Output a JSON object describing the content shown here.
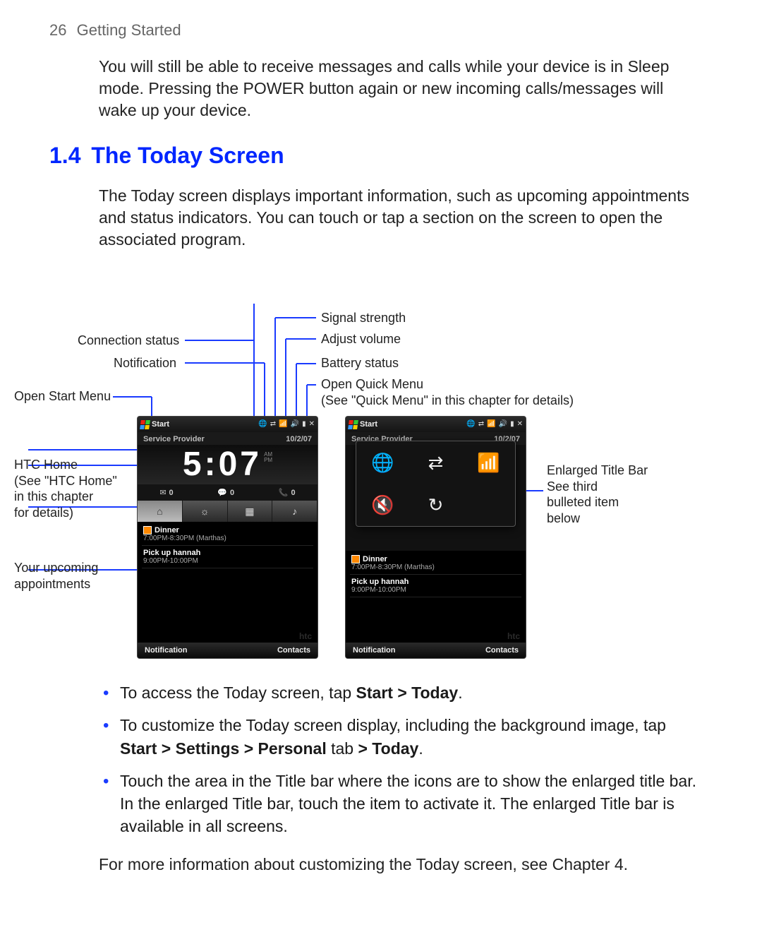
{
  "page": {
    "number": "26",
    "chapter": "Getting Started"
  },
  "intro_para": "You will still be able to receive messages and calls while your device is in Sleep mode. Pressing the POWER button again or new incoming calls/messages will wake up your device.",
  "section": {
    "number": "1.4",
    "title": "The Today Screen",
    "para": "The Today screen displays important information, such as upcoming appointments and status indicators. You can touch or tap a section on the screen to open the associated program."
  },
  "callouts": {
    "connection_status": "Connection status",
    "notification": "Notification",
    "open_start_menu": "Open Start Menu",
    "htc_home": "HTC Home\n(See \"HTC Home\"\nin this chapter\nfor details)",
    "your_upcoming": "Your upcoming\nappointments",
    "signal_strength": "Signal strength",
    "adjust_volume": "Adjust volume",
    "battery_status": "Battery status",
    "open_quick_menu": "Open Quick Menu\n(See \"Quick Menu\" in this chapter for details)",
    "enlarged_title_bar": "Enlarged Title Bar\nSee third\nbulleted item\nbelow"
  },
  "phone": {
    "start_label": "Start",
    "provider": "Service Provider",
    "date": "10/2/07",
    "clock_time": "5:07",
    "ampm_top": "AM",
    "ampm_bottom": "PM",
    "counters": [
      {
        "icon": "✉",
        "value": "0"
      },
      {
        "icon": "💬",
        "value": "0"
      },
      {
        "icon": "📞",
        "value": "0"
      }
    ],
    "appointments": [
      {
        "title": "Dinner",
        "detail": "7:00PM-8:30PM (Marthas)"
      },
      {
        "title": "Pick up hannah",
        "detail": "9:00PM-10:00PM"
      }
    ],
    "softkeys": {
      "left": "Notification",
      "right": "Contacts"
    },
    "htc_logo": "htc"
  },
  "bullets": {
    "b1_pre": "To access the Today screen, tap ",
    "b1_bold": "Start > Today",
    "b1_post": ".",
    "b2_pre": "To customize the Today screen display, including the background image, tap ",
    "b2_bold": "Start > Settings > Personal",
    "b2_mid": " tab ",
    "b2_bold2": "> Today",
    "b2_post": ".",
    "b3": "Touch the area in the Title bar where the icons are to show the enlarged title bar. In the enlarged Title bar, touch the item to activate it. The enlarged Title bar is available in all screens."
  },
  "closing": "For more information about customizing the Today screen, see Chapter 4."
}
